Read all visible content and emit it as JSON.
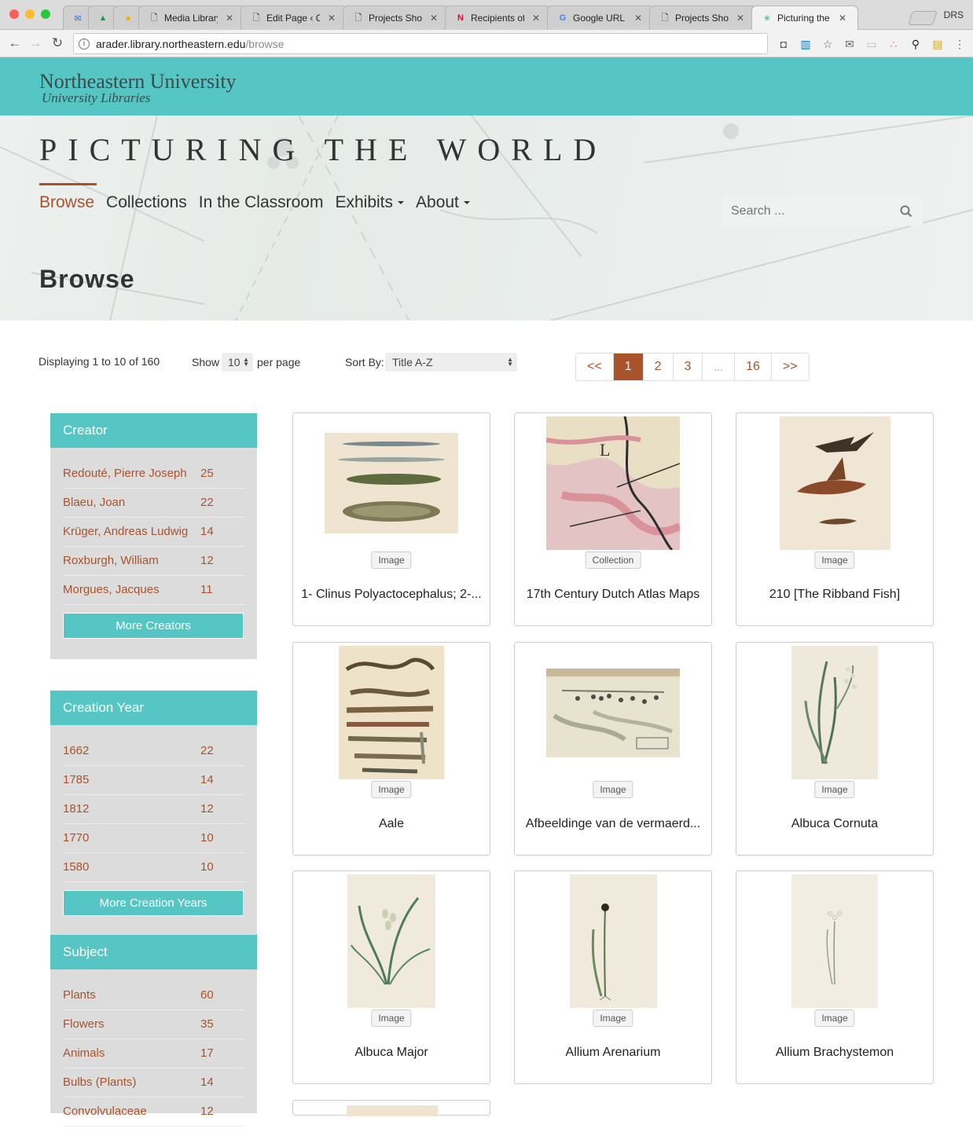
{
  "browser": {
    "tabs": [
      {
        "title": "",
        "icon": "mail-icon"
      },
      {
        "title": "",
        "icon": "drive-icon"
      },
      {
        "title": "",
        "icon": "star-icon"
      },
      {
        "title": "Media Library",
        "icon": "page-icon"
      },
      {
        "title": "Edit Page ‹ CE",
        "icon": "page-icon"
      },
      {
        "title": "Projects Show",
        "icon": "page-icon"
      },
      {
        "title": "Recipients of t",
        "icon": "n-icon"
      },
      {
        "title": "Google URL Sh",
        "icon": "google-icon"
      },
      {
        "title": "Projects Show",
        "icon": "page-icon"
      },
      {
        "title": "Picturing the W",
        "icon": "site-icon"
      }
    ],
    "profile": "DRS",
    "url_host": "arader.library.northeastern.edu",
    "url_path": "/browse"
  },
  "site": {
    "university": "Northeastern University",
    "libraries": "University Libraries",
    "title": "PICTURING THE WORLD",
    "nav": [
      {
        "label": "Browse",
        "active": true,
        "dropdown": false
      },
      {
        "label": "Collections",
        "active": false,
        "dropdown": false
      },
      {
        "label": "In the Classroom",
        "active": false,
        "dropdown": false
      },
      {
        "label": "Exhibits",
        "active": false,
        "dropdown": true
      },
      {
        "label": "About",
        "active": false,
        "dropdown": true
      }
    ],
    "search_placeholder": "Search ...",
    "page_heading": "Browse",
    "accent_color": "#a8532c",
    "teal_color": "#55c6c3"
  },
  "results": {
    "displaying": "Displaying 1 to 10 of 160",
    "show_label": "Show",
    "per_page_value": "10",
    "per_page_label": "per page",
    "sort_label": "Sort By:",
    "sort_value": "Title A-Z",
    "pagination": [
      "<<",
      "1",
      "2",
      "3",
      "...",
      "16",
      ">>"
    ],
    "current_page": "1"
  },
  "facets": [
    {
      "title": "Creator",
      "rows": [
        {
          "label": "Redouté, Pierre Joseph",
          "count": "25"
        },
        {
          "label": "Blaeu, Joan",
          "count": "22"
        },
        {
          "label": "Krüger, Andreas Ludwig",
          "count": "14"
        },
        {
          "label": "Roxburgh, William",
          "count": "12"
        },
        {
          "label": "Morgues, Jacques",
          "count": "11"
        }
      ],
      "button": "More Creators"
    },
    {
      "title": "Creation Year",
      "rows": [
        {
          "label": "1662",
          "count": "22"
        },
        {
          "label": "1785",
          "count": "14"
        },
        {
          "label": "1812",
          "count": "12"
        },
        {
          "label": "1770",
          "count": "10"
        },
        {
          "label": "1580",
          "count": "10"
        }
      ],
      "button": "More Creation Years"
    },
    {
      "title": "Subject",
      "rows": [
        {
          "label": "Plants",
          "count": "60"
        },
        {
          "label": "Flowers",
          "count": "35"
        },
        {
          "label": "Animals",
          "count": "17"
        },
        {
          "label": "Bulbs (Plants)",
          "count": "14"
        },
        {
          "label": "Convolvulaceae",
          "count": "12"
        }
      ]
    }
  ],
  "cards": [
    {
      "type": "Image",
      "title": "1- Clinus Polyactocephalus; 2-...",
      "thumb": "fish-plate"
    },
    {
      "type": "Collection",
      "title": "17th Century Dutch Atlas Maps",
      "thumb": "map"
    },
    {
      "type": "Image",
      "title": "210 [The Ribband Fish]",
      "thumb": "ribband-fish"
    },
    {
      "type": "Image",
      "title": "Aale",
      "thumb": "eels"
    },
    {
      "type": "Image",
      "title": "Afbeeldinge van de vermaerd...",
      "thumb": "seascape"
    },
    {
      "type": "Image",
      "title": "Albuca Cornuta",
      "thumb": "botanical"
    },
    {
      "type": "Image",
      "title": "Albuca Major",
      "thumb": "botanical"
    },
    {
      "type": "Image",
      "title": "Allium Arenarium",
      "thumb": "botanical"
    },
    {
      "type": "Image",
      "title": "Allium Brachystemon",
      "thumb": "botanical"
    }
  ]
}
